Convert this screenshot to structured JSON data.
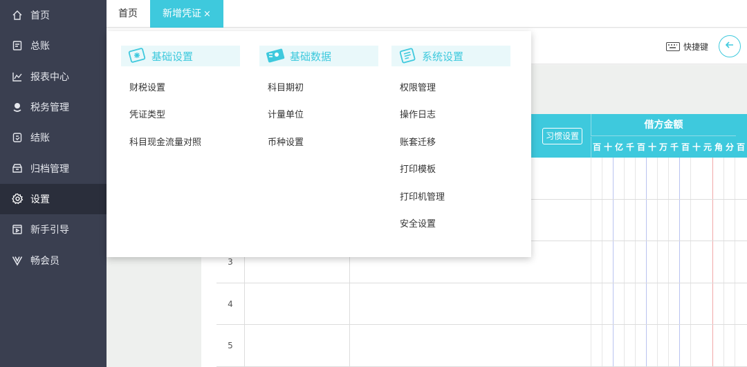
{
  "sidebar": {
    "items": [
      {
        "label": "首页",
        "icon": "home-icon"
      },
      {
        "label": "总账",
        "icon": "ledger-icon"
      },
      {
        "label": "报表中心",
        "icon": "chart-icon"
      },
      {
        "label": "税务管理",
        "icon": "tax-icon"
      },
      {
        "label": "结账",
        "icon": "checkout-icon"
      },
      {
        "label": "归档管理",
        "icon": "archive-icon"
      },
      {
        "label": "设置",
        "icon": "gear-icon",
        "active": true
      },
      {
        "label": "新手引导",
        "icon": "guide-icon"
      },
      {
        "label": "畅会员",
        "icon": "vip-icon"
      }
    ]
  },
  "tabs": {
    "home": "首页",
    "active": "新增凭证",
    "close": "×"
  },
  "toolbar": {
    "shortcut_label": "快捷键"
  },
  "voucher": {
    "habit_button": "习惯设置",
    "debit_title": "借方金额",
    "digits": [
      "百",
      "十",
      "亿",
      "千",
      "百",
      "十",
      "万",
      "千",
      "百",
      "十",
      "元",
      "角",
      "分",
      "百"
    ],
    "row_numbers": [
      "3",
      "4",
      "5"
    ]
  },
  "menu": {
    "columns": [
      {
        "title": "基础设置",
        "icon": "basic-settings-icon",
        "items": [
          "财税设置",
          "凭证类型",
          "科目现金流量对照"
        ]
      },
      {
        "title": "基础数据",
        "icon": "basic-data-icon",
        "items": [
          "科目期初",
          "计量单位",
          "币种设置"
        ]
      },
      {
        "title": "系统设置",
        "icon": "system-settings-icon",
        "items": [
          "权限管理",
          "操作日志",
          "账套迁移",
          "打印模板",
          "打印机管理",
          "安全设置"
        ]
      }
    ]
  },
  "colors": {
    "accent": "#3ec9dd",
    "sidebar_bg": "#3a3f50",
    "sidebar_active_bg": "#2a2e3b"
  }
}
